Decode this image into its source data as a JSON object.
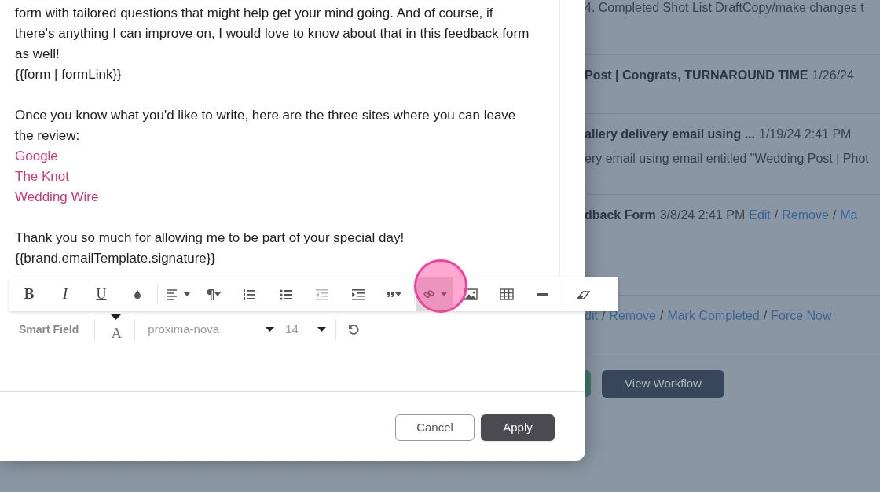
{
  "background_page": {
    "rows": [
      {
        "lines": [
          [
            {
              "kind": "plain",
              "text": "4. Completed Shot List DraftCopy/make changes t"
            }
          ]
        ]
      },
      {
        "lines": [
          [
            {
              "kind": "bold",
              "text": "Post | Congrats, TURNAROUND TIME"
            },
            {
              "kind": "plain",
              "text": "1/26/24"
            }
          ]
        ]
      },
      {
        "lines": [
          [
            {
              "kind": "bold",
              "text": "allery delivery email using ..."
            },
            {
              "kind": "plain",
              "text": "1/19/24 2:41 PM"
            }
          ],
          [
            {
              "kind": "plain",
              "text": "ery email using email entitled \"Wedding Post | Phot"
            }
          ]
        ]
      },
      {
        "lines": [
          [
            {
              "kind": "bold",
              "text": "dback Form"
            },
            {
              "kind": "plain",
              "text": "3/8/24 2:41 PM"
            },
            {
              "kind": "link",
              "text": "Edit"
            },
            {
              "kind": "sep",
              "text": "/"
            },
            {
              "kind": "link",
              "text": "Remove"
            },
            {
              "kind": "sep",
              "text": "/"
            },
            {
              "kind": "link",
              "text": "Ma"
            }
          ]
        ]
      },
      {
        "lines": [
          [
            {
              "kind": "link",
              "text": "dit"
            },
            {
              "kind": "sep",
              "text": "/"
            },
            {
              "kind": "link",
              "text": "Remove"
            },
            {
              "kind": "sep",
              "text": "/"
            },
            {
              "kind": "link",
              "text": "Mark Completed"
            },
            {
              "kind": "sep",
              "text": "/"
            },
            {
              "kind": "link",
              "text": "Force Now"
            }
          ]
        ]
      }
    ],
    "view_workflow_button": "View Workflow"
  },
  "editor": {
    "paragraphs": [
      [
        {
          "kind": "text",
          "text": "form with tailored questions that might help get your mind going. And of course, if there's anything I can improve on, I would love to know about that in this feedback form as well!"
        },
        {
          "kind": "text",
          "text": "{{form | formLink}}"
        }
      ],
      [
        {
          "kind": "text",
          "text": "Once you know what you'd like to write, here are the three sites where you can leave the review:"
        },
        {
          "kind": "link",
          "text": "Google"
        },
        {
          "kind": "link",
          "text": "The Knot"
        },
        {
          "kind": "link",
          "text": "Wedding Wire"
        }
      ],
      [
        {
          "kind": "text",
          "text": "Thank you so much for allowing me to be part of your special day!"
        },
        {
          "kind": "text",
          "text": "{{brand.emailTemplate.signature}}"
        }
      ]
    ],
    "toolbar": [
      [
        {
          "kind": "bold",
          "label": "B",
          "selected": false,
          "disabled": false
        },
        {
          "kind": "italic",
          "label": "I",
          "selected": false,
          "disabled": false
        },
        {
          "kind": "underline",
          "label": "U",
          "selected": false,
          "disabled": false
        },
        {
          "kind": "color",
          "selected": false,
          "disabled": false
        }
      ],
      [
        {
          "kind": "align",
          "selected": false,
          "disabled": false
        },
        {
          "kind": "paragraph",
          "selected": false,
          "disabled": false
        },
        {
          "kind": "ordered-list",
          "selected": false,
          "disabled": false
        },
        {
          "kind": "bullet-list",
          "selected": false,
          "disabled": false
        },
        {
          "kind": "outdent",
          "selected": false,
          "disabled": true
        },
        {
          "kind": "indent",
          "selected": false,
          "disabled": false
        },
        {
          "kind": "quote",
          "selected": false,
          "disabled": false
        }
      ],
      [
        {
          "kind": "link",
          "selected": true,
          "disabled": false
        },
        {
          "kind": "image",
          "selected": false,
          "disabled": false
        },
        {
          "kind": "table",
          "selected": false,
          "disabled": false
        },
        {
          "kind": "rule",
          "selected": false,
          "disabled": false
        }
      ],
      [
        {
          "kind": "eraser",
          "selected": false,
          "disabled": false
        }
      ]
    ],
    "format_bar": {
      "smart_field": "Smart Field",
      "font_color": "A",
      "font_family": "proxima-nova",
      "font_size": "14"
    }
  },
  "buttons": [
    {
      "kind": "secondary",
      "label": "Cancel"
    },
    {
      "kind": "primary",
      "label": "Apply"
    }
  ]
}
